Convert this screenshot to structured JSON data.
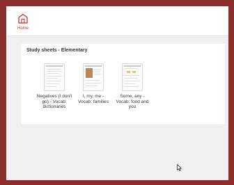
{
  "topbar": {
    "home_label": "Home"
  },
  "panel": {
    "title": "Study sheets - Elementary"
  },
  "sheets": [
    {
      "caption_lines": [
        "Negatives (I don't",
        "go) - Vocab:",
        "dictionaries"
      ]
    },
    {
      "caption_lines": [
        "I, my, me -",
        "Vocab: families"
      ]
    },
    {
      "caption_lines": [
        "Some, any -",
        "Vocab: food and",
        "you"
      ]
    }
  ],
  "colors": {
    "outer_border": "#8a2f2b",
    "accent": "#c9302c",
    "page_background": "#f0f0f0"
  },
  "icons": {
    "home": "home-icon",
    "cursor": "mouse-pointer-icon"
  }
}
